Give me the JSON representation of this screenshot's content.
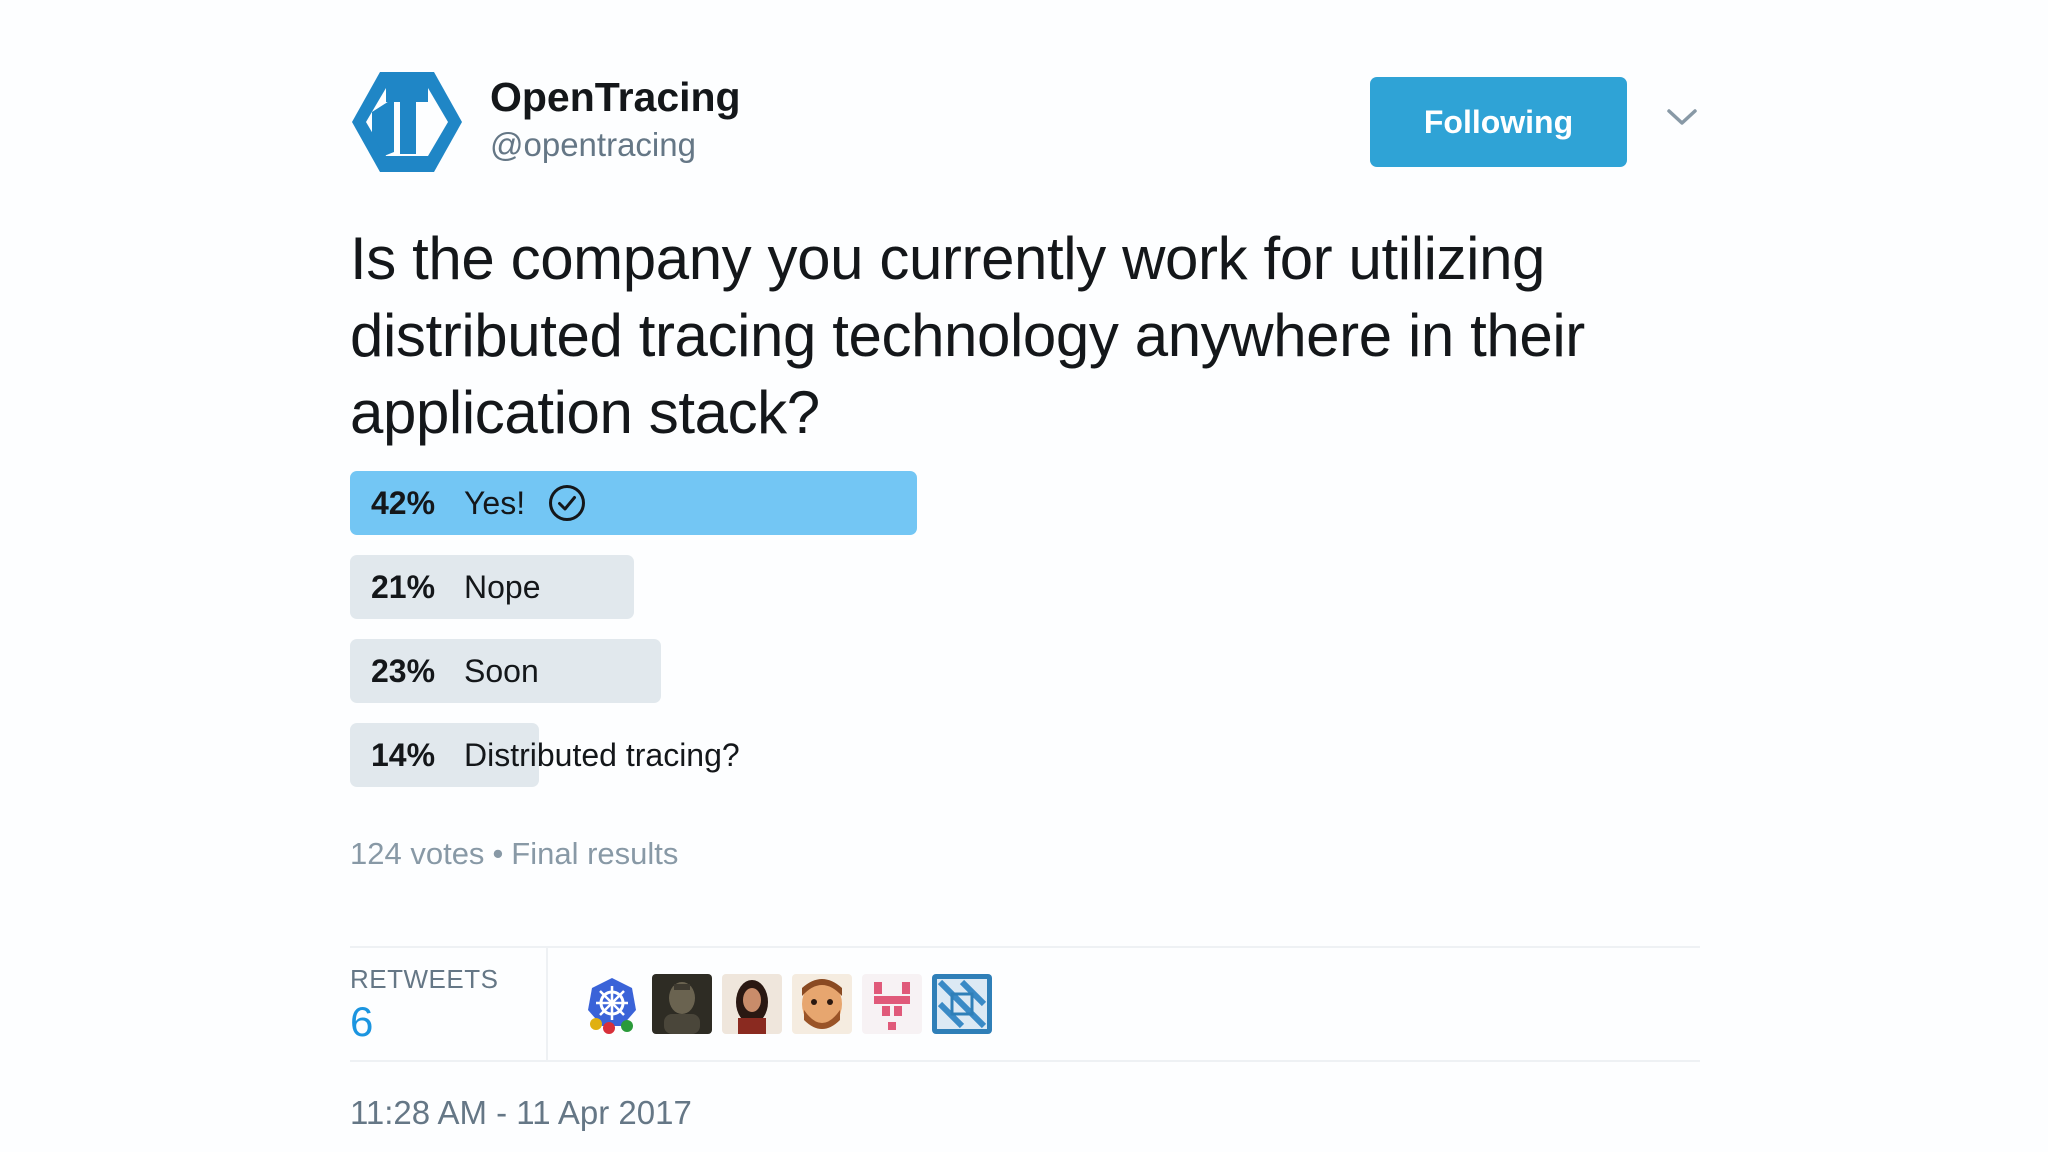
{
  "header": {
    "display_name": "OpenTracing",
    "handle": "@opentracing",
    "follow_label": "Following"
  },
  "tweet": {
    "text": "Is the company you currently work for utilizing distributed tracing technology anywhere in their application stack?"
  },
  "poll": {
    "options": [
      {
        "percent_label": "42%",
        "percent": 42,
        "label": "Yes!",
        "winner": true
      },
      {
        "percent_label": "21%",
        "percent": 21,
        "label": "Nope",
        "winner": false
      },
      {
        "percent_label": "23%",
        "percent": 23,
        "label": "Soon",
        "winner": false
      },
      {
        "percent_label": "14%",
        "percent": 14,
        "label": "Distributed tracing?",
        "winner": false
      }
    ],
    "votes": "124 votes",
    "separator": "•",
    "status": "Final results"
  },
  "stats": {
    "retweets_label": "RETWEETS",
    "retweets_count": "6",
    "retweeter_avatars": [
      "kubernetes-logo-avatar",
      "dark-portrait-avatar",
      "woman-portrait-avatar",
      "cartoon-man-avatar",
      "pixel-art-avatar",
      "blue-pattern-avatar"
    ]
  },
  "timestamp": "11:28 AM - 11 Apr 2017",
  "colors": {
    "accent": "#2fa3d6",
    "winner_bar": "#73c6f4",
    "bar": "#e1e8ed",
    "link": "#1b95e0"
  }
}
